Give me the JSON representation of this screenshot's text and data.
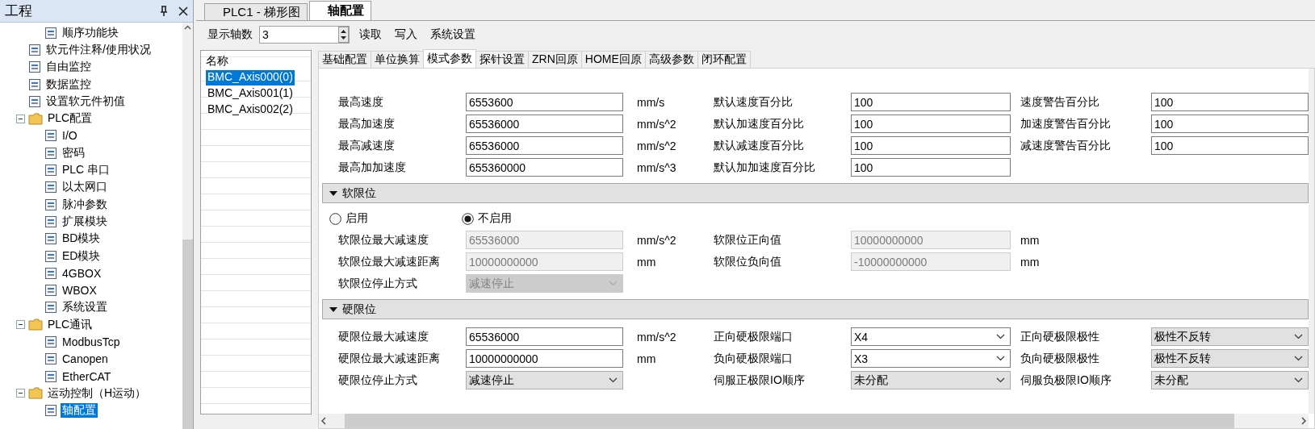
{
  "project_panel": {
    "title": "工程",
    "tree": [
      {
        "children": [
          {
            "label": "顺序功能块",
            "selected": false
          }
        ]
      },
      {
        "label": "软元件注释/使用状况",
        "selected": false
      },
      {
        "label": "自由监控",
        "selected": false
      },
      {
        "label": "数据监控",
        "selected": false
      },
      {
        "label": "设置软元件初值",
        "selected": false
      },
      {
        "label": "PLC配置",
        "selected": false,
        "expanded": true,
        "children": [
          {
            "label": "I/O",
            "selected": false
          },
          {
            "label": "密码",
            "selected": false
          },
          {
            "label": "PLC 串口",
            "selected": false
          },
          {
            "label": "以太网口",
            "selected": false
          },
          {
            "label": "脉冲参数",
            "selected": false
          },
          {
            "label": "扩展模块",
            "selected": false
          },
          {
            "label": "BD模块",
            "selected": false
          },
          {
            "label": "ED模块",
            "selected": false
          },
          {
            "label": "4GBOX",
            "selected": false
          },
          {
            "label": "WBOX",
            "selected": false
          },
          {
            "label": "系统设置",
            "selected": false
          }
        ]
      },
      {
        "label": "PLC通讯",
        "selected": false,
        "expanded": true,
        "children": [
          {
            "label": "ModbusTcp",
            "selected": false
          },
          {
            "label": "Canopen",
            "selected": false
          },
          {
            "label": "EtherCAT",
            "selected": false
          }
        ]
      },
      {
        "label": "运动控制（H运动）",
        "selected": false,
        "expanded": true,
        "children": [
          {
            "label": "轴配置",
            "selected": true
          }
        ]
      }
    ]
  },
  "doc_tabs": [
    {
      "label": "PLC1 - 梯形图",
      "selected": false
    },
    {
      "label": "轴配置",
      "selected": true
    }
  ],
  "toolbar": {
    "axis_count_label": "显示轴数",
    "axis_count": "3",
    "buttons": [
      "读取",
      "写入",
      "系统设置"
    ]
  },
  "axis_list": {
    "header": "名称",
    "items": [
      {
        "label": "BMC_Axis000(0)",
        "selected": true
      },
      {
        "label": "BMC_Axis001(1)",
        "selected": false
      },
      {
        "label": "BMC_Axis002(2)",
        "selected": false
      }
    ]
  },
  "settings_tabs": [
    {
      "label": "基础配置",
      "selected": false
    },
    {
      "label": "单位换算",
      "selected": false
    },
    {
      "label": "模式参数",
      "selected": true
    },
    {
      "label": "探针设置",
      "selected": false
    },
    {
      "label": "ZRN回原",
      "selected": false
    },
    {
      "label": "HOME回原",
      "selected": false
    },
    {
      "label": "高级参数",
      "selected": false
    },
    {
      "label": "闭环配置",
      "selected": false
    }
  ],
  "sections": [
    {
      "rows": [
        [
          {
            "label": "最高速度",
            "value": "6553600",
            "kind": "input",
            "disabled": false,
            "unit": "mm/s"
          },
          {
            "label": "默认速度百分比",
            "value": "100",
            "kind": "input",
            "disabled": false
          },
          {
            "label": "速度警告百分比",
            "value": "100",
            "kind": "input",
            "disabled": false
          }
        ],
        [
          {
            "label": "最高加速度",
            "value": "65536000",
            "kind": "input",
            "disabled": false,
            "unit": "mm/s^2"
          },
          {
            "label": "默认加速度百分比",
            "value": "100",
            "kind": "input",
            "disabled": false
          },
          {
            "label": "加速度警告百分比",
            "value": "100",
            "kind": "input",
            "disabled": false
          }
        ],
        [
          {
            "label": "最高减速度",
            "value": "65536000",
            "kind": "input",
            "disabled": false,
            "unit": "mm/s^2"
          },
          {
            "label": "默认减速度百分比",
            "value": "100",
            "kind": "input",
            "disabled": false
          },
          {
            "label": "减速度警告百分比",
            "value": "100",
            "kind": "input",
            "disabled": false
          }
        ],
        [
          {
            "label": "最高加加速度",
            "value": "655360000",
            "kind": "input",
            "disabled": false,
            "unit": "mm/s^3"
          },
          {
            "label": "默认加加速度百分比",
            "value": "100",
            "kind": "input",
            "disabled": false
          }
        ]
      ]
    },
    {
      "title": "软限位",
      "expanded": true,
      "radios": [
        {
          "label": "启用",
          "selected": false
        },
        {
          "label": "不启用",
          "selected": true
        }
      ],
      "rows": [
        [
          {
            "label": "软限位最大减速度",
            "value": "65536000",
            "kind": "input",
            "disabled": true,
            "unit": "mm/s^2"
          },
          {
            "label": "软限位正向值",
            "value": "10000000000",
            "kind": "input",
            "disabled": true,
            "unit": "mm"
          }
        ],
        [
          {
            "label": "软限位最大减速距离",
            "value": "10000000000",
            "kind": "input",
            "disabled": true,
            "unit": "mm"
          },
          {
            "label": "软限位负向值",
            "value": "-10000000000",
            "kind": "input",
            "disabled": true,
            "unit": "mm"
          }
        ],
        [
          {
            "label": "软限位停止方式",
            "value": "减速停止",
            "kind": "select",
            "disabled": true
          }
        ]
      ]
    },
    {
      "title": "硬限位",
      "expanded": true,
      "rows": [
        [
          {
            "label": "硬限位最大减速度",
            "value": "65536000",
            "kind": "input",
            "disabled": false,
            "unit": "mm/s^2"
          },
          {
            "label": "正向硬极限端口",
            "value": "X4",
            "kind": "combo",
            "disabled": false
          },
          {
            "label": "正向硬极限极性",
            "value": "极性不反转",
            "kind": "select",
            "disabled": false
          }
        ],
        [
          {
            "label": "硬限位最大减速距离",
            "value": "10000000000",
            "kind": "input",
            "disabled": false,
            "unit": "mm"
          },
          {
            "label": "负向硬极限端口",
            "value": "X3",
            "kind": "combo",
            "disabled": false
          },
          {
            "label": "负向硬极限极性",
            "value": "极性不反转",
            "kind": "select",
            "disabled": false
          }
        ],
        [
          {
            "label": "硬限位停止方式",
            "value": "减速停止",
            "kind": "select",
            "disabled": false
          },
          {
            "label": "伺服正极限IO顺序",
            "value": "未分配",
            "kind": "select",
            "disabled": false
          },
          {
            "label": "伺服负极限IO顺序",
            "value": "未分配",
            "kind": "select",
            "disabled": false
          }
        ]
      ]
    }
  ]
}
